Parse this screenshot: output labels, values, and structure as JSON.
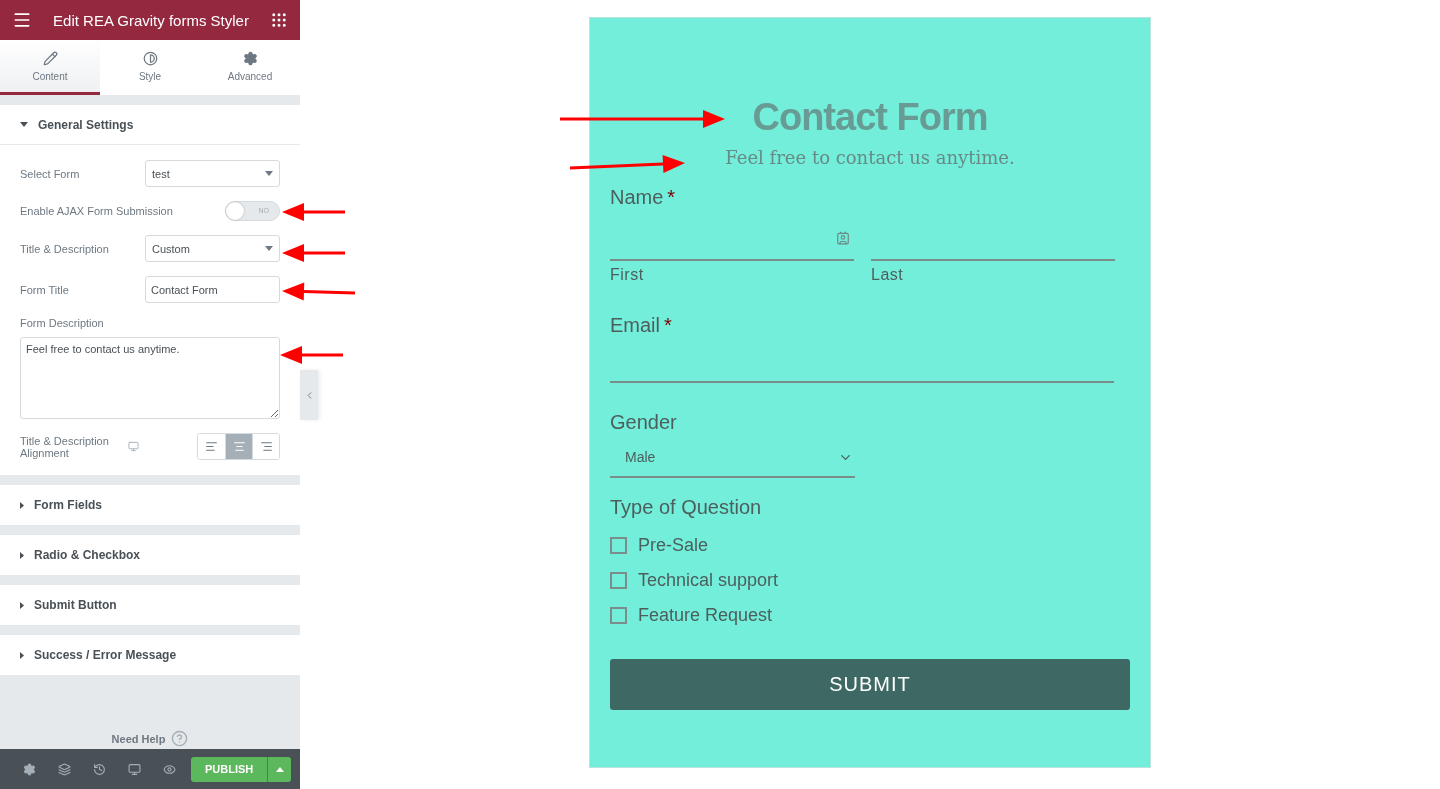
{
  "panel": {
    "title": "Edit REA Gravity forms Styler",
    "tabs": [
      {
        "label": "Content",
        "selected": true
      },
      {
        "label": "Style",
        "selected": false
      },
      {
        "label": "Advanced",
        "selected": false
      }
    ],
    "sections": [
      {
        "title": "General Settings",
        "expanded": true,
        "controls": [
          {
            "kind": "select",
            "label": "Select Form",
            "value": "test"
          },
          {
            "kind": "toggle",
            "label": "Enable AJAX Form Submission",
            "on": false,
            "text": "NO"
          },
          {
            "kind": "select",
            "label": "Title & Description",
            "value": "Custom"
          },
          {
            "kind": "text",
            "label": "Form Title",
            "value": "Contact Form"
          },
          {
            "kind": "textarea",
            "label": "Form Description",
            "value": "Feel free to contact us anytime."
          },
          {
            "kind": "align",
            "label": "Title & Description Alignment",
            "options": [
              {
                "selected": false
              },
              {
                "selected": true
              },
              {
                "selected": false
              }
            ]
          }
        ]
      },
      {
        "title": "Form Fields",
        "expanded": false
      },
      {
        "title": "Radio & Checkbox",
        "expanded": false
      },
      {
        "title": "Submit Button",
        "expanded": false
      },
      {
        "title": "Success / Error Message",
        "expanded": false
      }
    ],
    "help": "Need Help",
    "publish": "PUBLISH"
  },
  "form": {
    "title": "Contact Form",
    "description": "Feel free to contact us anytime.",
    "fields": [
      {
        "kind": "name",
        "label": "Name",
        "required_mark": "*",
        "sublabels": [
          "First",
          "Last"
        ]
      },
      {
        "kind": "email",
        "label": "Email",
        "required_mark": "*"
      },
      {
        "kind": "select",
        "label": "Gender",
        "value": "Male"
      },
      {
        "kind": "checkboxes",
        "label": "Type of Question",
        "options": [
          {
            "label": "Pre-Sale",
            "checked": false
          },
          {
            "label": "Technical support",
            "checked": false
          },
          {
            "label": "Feature Request",
            "checked": false
          }
        ]
      }
    ],
    "submit": "SUBMIT"
  }
}
